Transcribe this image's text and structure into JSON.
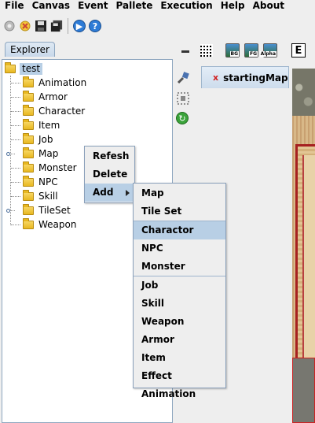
{
  "menubar": [
    "File",
    "Canvas",
    "Event",
    "Pallete",
    "Execution",
    "Help",
    "About"
  ],
  "toolbar": {
    "icons": [
      "settings-icon",
      "new-icon",
      "save-icon",
      "save-all-icon",
      "run-icon",
      "help-icon"
    ],
    "run_glyph": "▶",
    "help_glyph": "?"
  },
  "explorer": {
    "tab_label": "Explorer",
    "root": "test",
    "items": [
      "Animation",
      "Armor",
      "Character",
      "Item",
      "Job",
      "Map",
      "Monster",
      "NPC",
      "Skill",
      "TileSet",
      "Weapon"
    ],
    "expandable": [
      "Map",
      "TileSet"
    ]
  },
  "right_toolbar": {
    "bg_label": "BG",
    "fg_label": "FG",
    "alpha_label": "Alpha",
    "e_label": "E"
  },
  "document_tab": {
    "close": "x",
    "title": "startingMap"
  },
  "context_menu": {
    "items": [
      "Refesh",
      "Delete",
      "Add"
    ],
    "highlighted": "Add"
  },
  "add_submenu": {
    "group1": [
      "Map",
      "Tile Set"
    ],
    "group2": [
      "Charactor",
      "NPC",
      "Monster"
    ],
    "group3": [
      "Job",
      "Skill",
      "Weapon",
      "Armor",
      "Item",
      "Effect Animation"
    ],
    "highlighted": "Charactor"
  },
  "colors": {
    "selection": "#b8cfe5",
    "panel_border": "#8fa7c0",
    "close_x": "#d02020"
  }
}
